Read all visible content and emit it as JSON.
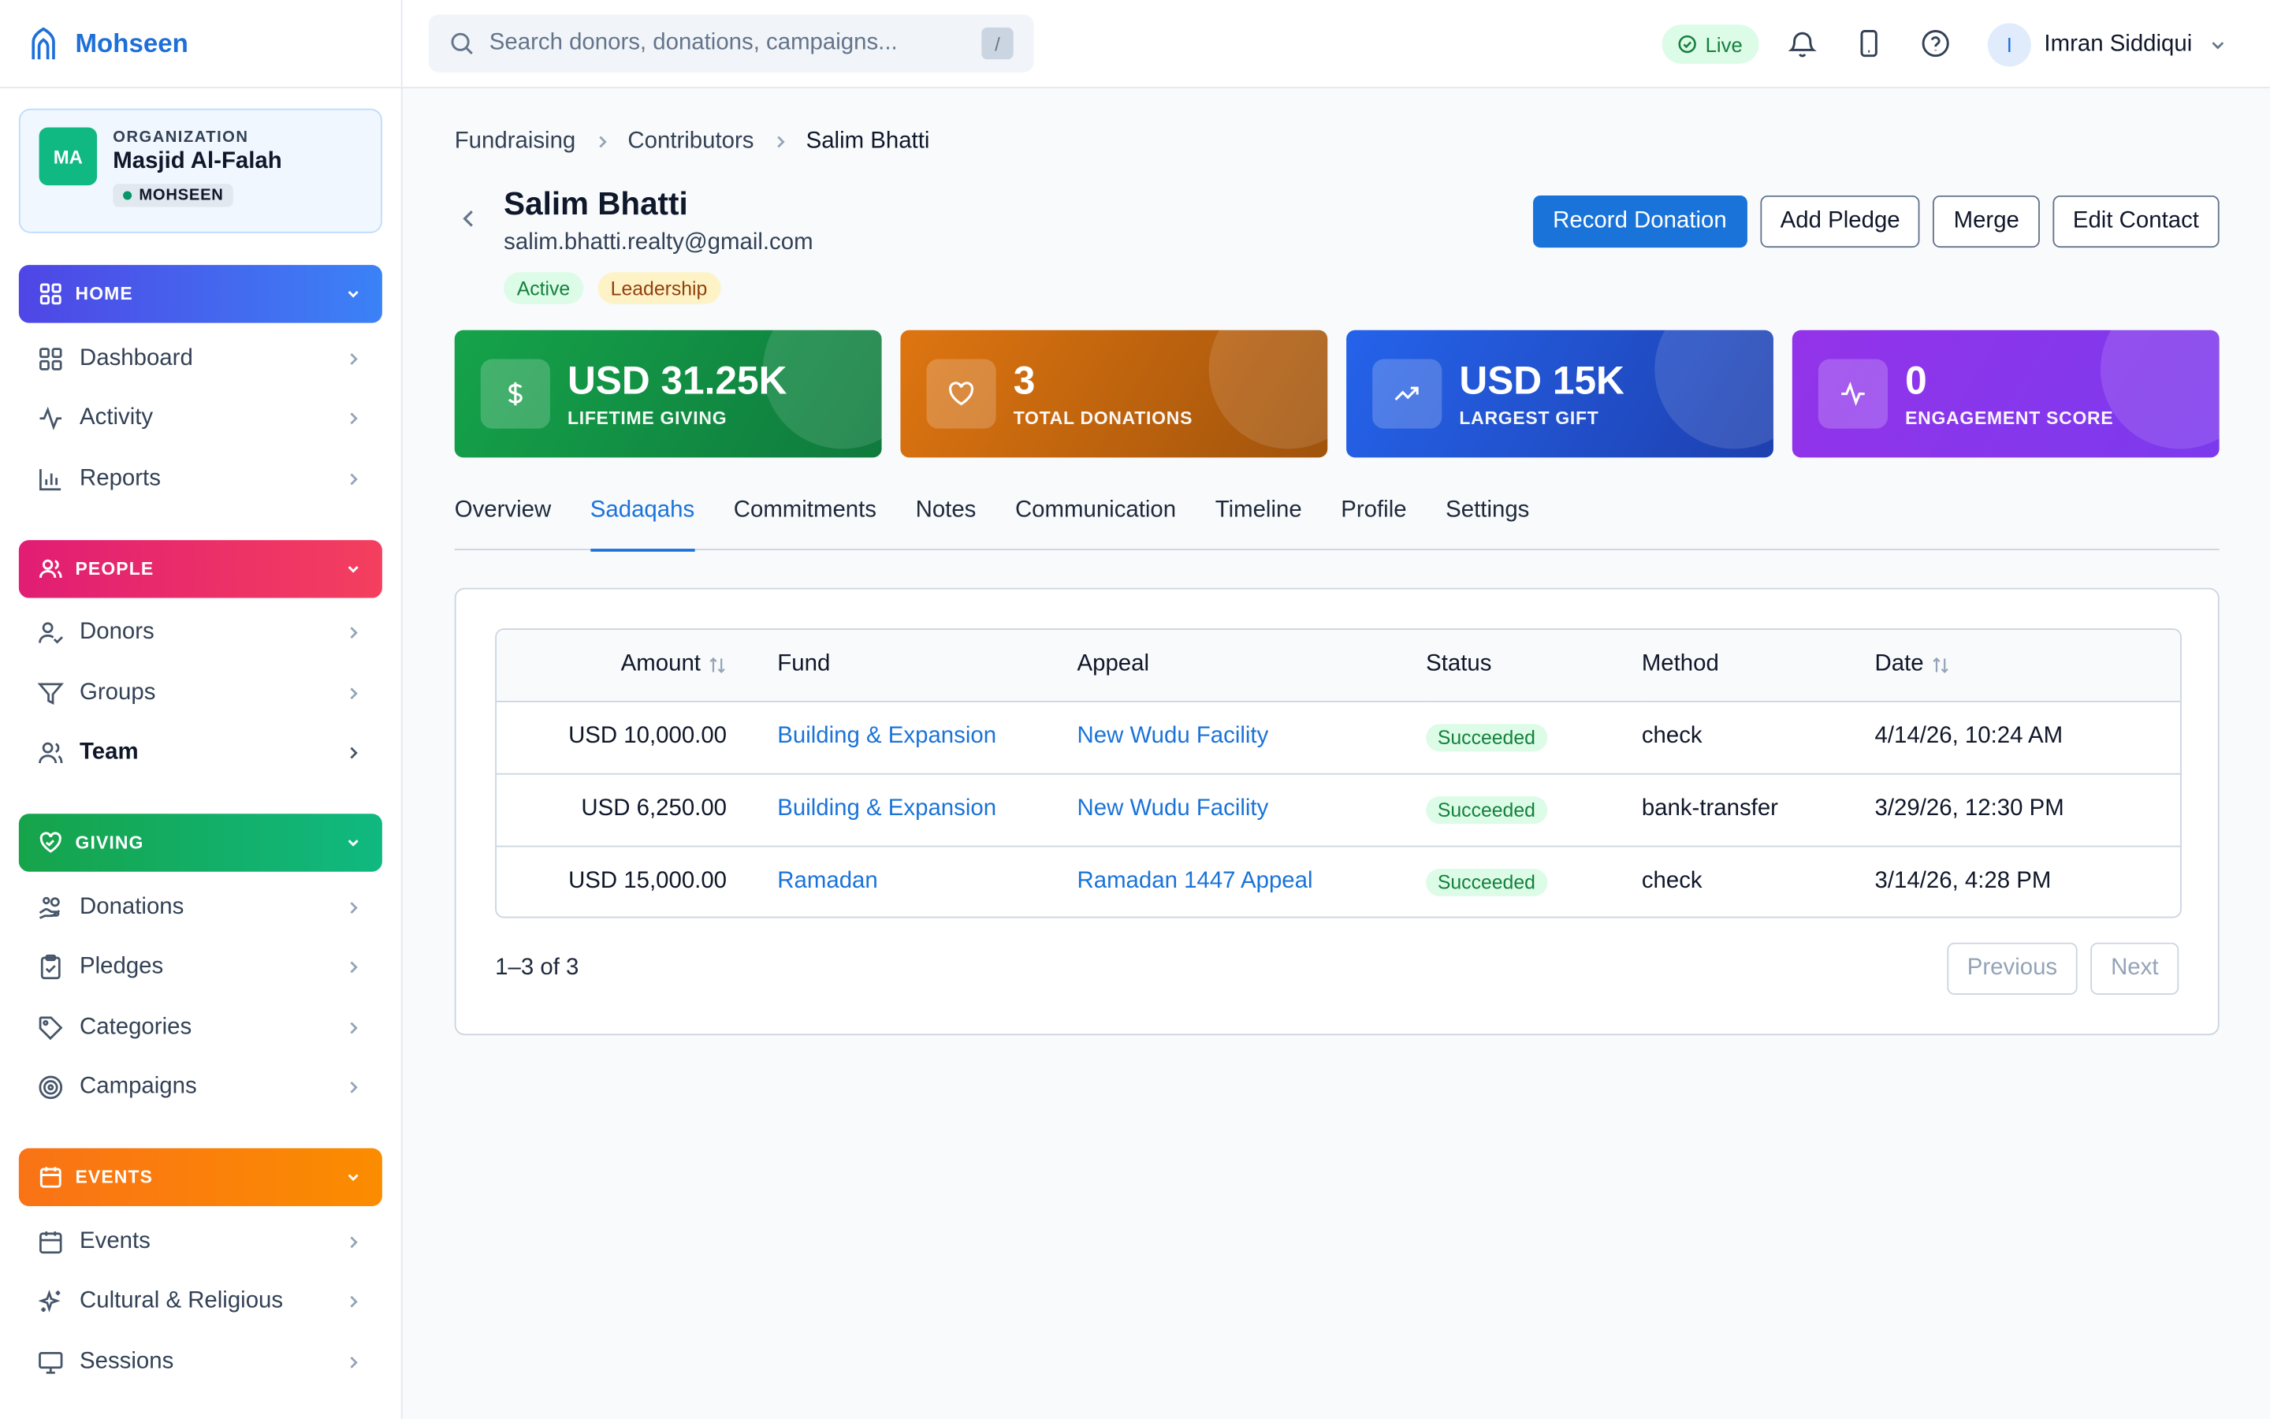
{
  "brand": {
    "name": "Mohseen",
    "icon": "mosque-arch-icon"
  },
  "org": {
    "initials": "MA",
    "kicker": "ORGANIZATION",
    "name": "Masjid Al-Falah",
    "tag": "MOHSEEN"
  },
  "sidebar": {
    "sections": [
      {
        "label": "HOME",
        "icon": "grid-icon",
        "color": "#4f46e5",
        "items": [
          {
            "label": "Dashboard",
            "icon": "grid-icon"
          },
          {
            "label": "Activity",
            "icon": "activity-icon"
          },
          {
            "label": "Reports",
            "icon": "bar-chart-icon"
          }
        ]
      },
      {
        "label": "PEOPLE",
        "icon": "users-icon",
        "color": "#e11d74",
        "items": [
          {
            "label": "Donors",
            "icon": "user-check-icon"
          },
          {
            "label": "Groups",
            "icon": "filter-icon"
          },
          {
            "label": "Team",
            "icon": "users-icon",
            "active": true
          }
        ]
      },
      {
        "label": "GIVING",
        "icon": "heart-handshake-icon",
        "color": "#16a34a",
        "items": [
          {
            "label": "Donations",
            "icon": "hand-coins-icon"
          },
          {
            "label": "Pledges",
            "icon": "clipboard-check-icon"
          },
          {
            "label": "Categories",
            "icon": "tag-icon"
          },
          {
            "label": "Campaigns",
            "icon": "target-icon"
          }
        ]
      },
      {
        "label": "EVENTS",
        "icon": "calendar-icon",
        "color": "#f97316",
        "items": [
          {
            "label": "Events",
            "icon": "calendar-icon"
          },
          {
            "label": "Cultural & Religious",
            "icon": "sparkles-icon"
          },
          {
            "label": "Sessions",
            "icon": "monitor-icon"
          }
        ]
      }
    ]
  },
  "header": {
    "search_placeholder": "Search donors, donations, campaigns...",
    "search_value": "",
    "search_shortcut": "/",
    "live_label": "Live",
    "user_initial": "I",
    "user_name": "Imran Siddiqui"
  },
  "breadcrumb": {
    "items": [
      "Fundraising",
      "Contributors"
    ],
    "current": "Salim Bhatti"
  },
  "contact": {
    "name": "Salim Bhatti",
    "email": "salim.bhatti.realty@gmail.com",
    "tags": [
      "Active",
      "Leadership"
    ]
  },
  "actions": {
    "record_donation": "Record Donation",
    "add_pledge": "Add Pledge",
    "merge": "Merge",
    "edit_contact": "Edit Contact"
  },
  "stats": [
    {
      "value": "USD 31.25K",
      "label": "LIFETIME GIVING",
      "icon": "dollar-icon",
      "color": "#15a34a"
    },
    {
      "value": "3",
      "label": "TOTAL DONATIONS",
      "icon": "heart-icon",
      "color": "#de7510"
    },
    {
      "value": "USD 15K",
      "label": "LARGEST GIFT",
      "icon": "trending-up-icon",
      "color": "#2563eb"
    },
    {
      "value": "0",
      "label": "ENGAGEMENT SCORE",
      "icon": "activity-icon",
      "color": "#9333ea"
    }
  ],
  "tabs": {
    "items": [
      "Overview",
      "Sadaqahs",
      "Commitments",
      "Notes",
      "Communication",
      "Timeline",
      "Profile",
      "Settings"
    ],
    "selected": "Sadaqahs"
  },
  "table": {
    "columns": [
      "Amount",
      "Fund",
      "Appeal",
      "Status",
      "Method",
      "Date"
    ],
    "rows": [
      {
        "amount": "USD 10,000.00",
        "fund": "Building & Expansion",
        "appeal": "New Wudu Facility",
        "status": "Succeeded",
        "method": "check",
        "date": "4/14/26, 10:24 AM"
      },
      {
        "amount": "USD 6,250.00",
        "fund": "Building & Expansion",
        "appeal": "New Wudu Facility",
        "status": "Succeeded",
        "method": "bank-transfer",
        "date": "3/29/26, 12:30 PM"
      },
      {
        "amount": "USD 15,000.00",
        "fund": "Ramadan",
        "appeal": "Ramadan 1447 Appeal",
        "status": "Succeeded",
        "method": "check",
        "date": "3/14/26, 4:28 PM"
      }
    ]
  },
  "pagination": {
    "summary": "1–3 of 3",
    "previous": "Previous",
    "next": "Next"
  }
}
